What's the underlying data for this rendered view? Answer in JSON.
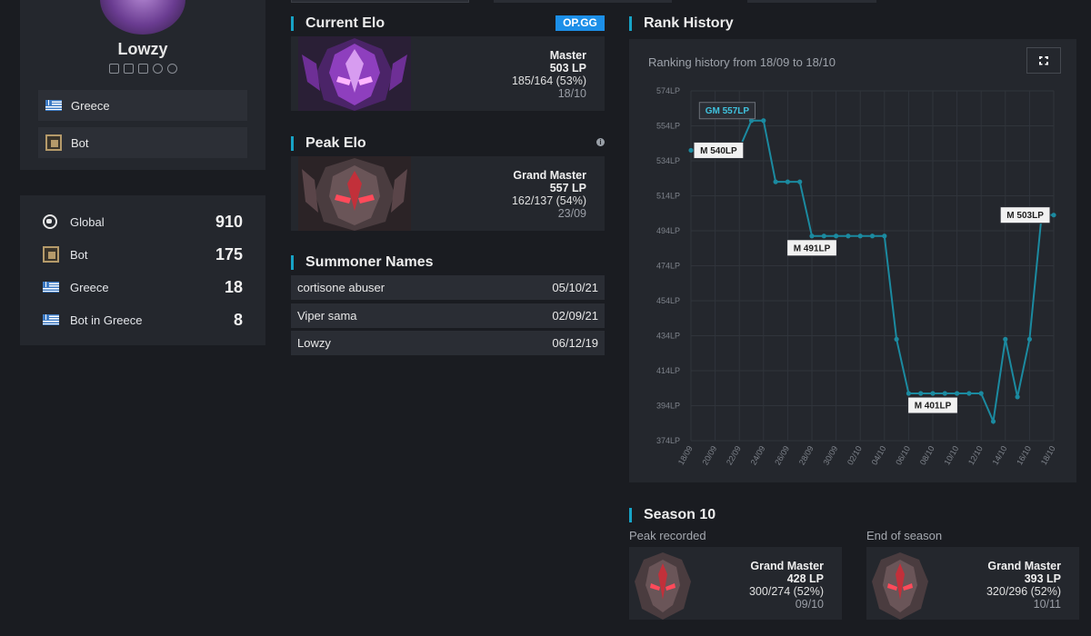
{
  "profile": {
    "name": "Lowzy",
    "country": "Greece",
    "role": "Bot"
  },
  "rankings": [
    {
      "label": "Global",
      "value": "910",
      "icon": "globe-icon"
    },
    {
      "label": "Bot",
      "value": "175",
      "icon": "bot-role-icon"
    },
    {
      "label": "Greece",
      "value": "18",
      "icon": "greece-flag-icon"
    },
    {
      "label": "Bot in Greece",
      "value": "8",
      "icon": "greece-flag-icon"
    }
  ],
  "current_elo": {
    "title": "Current Elo",
    "badge": "OP.GG",
    "tier": "Master",
    "lp": "503 LP",
    "record": "185/164 (53%)",
    "date": "18/10"
  },
  "peak_elo": {
    "title": "Peak Elo",
    "tier": "Grand Master",
    "lp": "557 LP",
    "record": "162/137 (54%)",
    "date": "23/09"
  },
  "summoner_names": {
    "title": "Summoner Names",
    "items": [
      {
        "name": "cortisone abuser",
        "date": "05/10/21"
      },
      {
        "name": "Viper sama",
        "date": "02/09/21"
      },
      {
        "name": "Lowzy",
        "date": "06/12/19"
      }
    ]
  },
  "rank_history": {
    "title": "Rank History",
    "subtitle": "Ranking history from 18/09 to 18/10"
  },
  "season": {
    "title": "Season 10",
    "peak_label": "Peak recorded",
    "end_label": "End of season",
    "peak": {
      "tier": "Grand Master",
      "lp": "428 LP",
      "record": "300/274 (52%)",
      "date": "09/10"
    },
    "end": {
      "tier": "Grand Master",
      "lp": "393 LP",
      "record": "320/296 (52%)",
      "date": "10/11"
    }
  },
  "colors": {
    "accent": "#17a3c6",
    "line": "#1b8aa0",
    "opgg": "#1c8fe8"
  },
  "chart_data": {
    "type": "line",
    "ylim": [
      374,
      574
    ],
    "yticks": [
      "574LP",
      "554LP",
      "534LP",
      "514LP",
      "494LP",
      "474LP",
      "454LP",
      "434LP",
      "414LP",
      "394LP",
      "374LP"
    ],
    "xticks": [
      "18/09",
      "20/09",
      "22/09",
      "24/09",
      "26/09",
      "28/09",
      "30/09",
      "02/10",
      "04/10",
      "06/10",
      "08/10",
      "10/10",
      "12/10",
      "14/10",
      "16/10",
      "18/10"
    ],
    "x": [
      0,
      1,
      2,
      2.5,
      3,
      3.5,
      4,
      4.5,
      5,
      5.5,
      6,
      6.5,
      7,
      7.5,
      8,
      8.5,
      9,
      9.5,
      10,
      10.5,
      11,
      11.5,
      12,
      12.5,
      13,
      13.5,
      14,
      14.5,
      15
    ],
    "series": [
      {
        "values": [
          540,
          540,
          541,
          557,
          557,
          522,
          522,
          522,
          491,
          491,
          491,
          491,
          491,
          491,
          491,
          432,
          401,
          401,
          401,
          401,
          401,
          401,
          401,
          385,
          432,
          399,
          432,
          503,
          503
        ]
      }
    ],
    "annotations": [
      {
        "text": "M 540LP",
        "x": 0,
        "y": 540,
        "highlight": false
      },
      {
        "text": "GM 557LP",
        "x": 2.5,
        "y": 557,
        "highlight": true
      },
      {
        "text": "M 491LP",
        "x": 5,
        "y": 491,
        "highlight": false
      },
      {
        "text": "M 401LP",
        "x": 10,
        "y": 401,
        "highlight": false
      },
      {
        "text": "M 503LP",
        "x": 15,
        "y": 503,
        "highlight": false
      }
    ]
  }
}
